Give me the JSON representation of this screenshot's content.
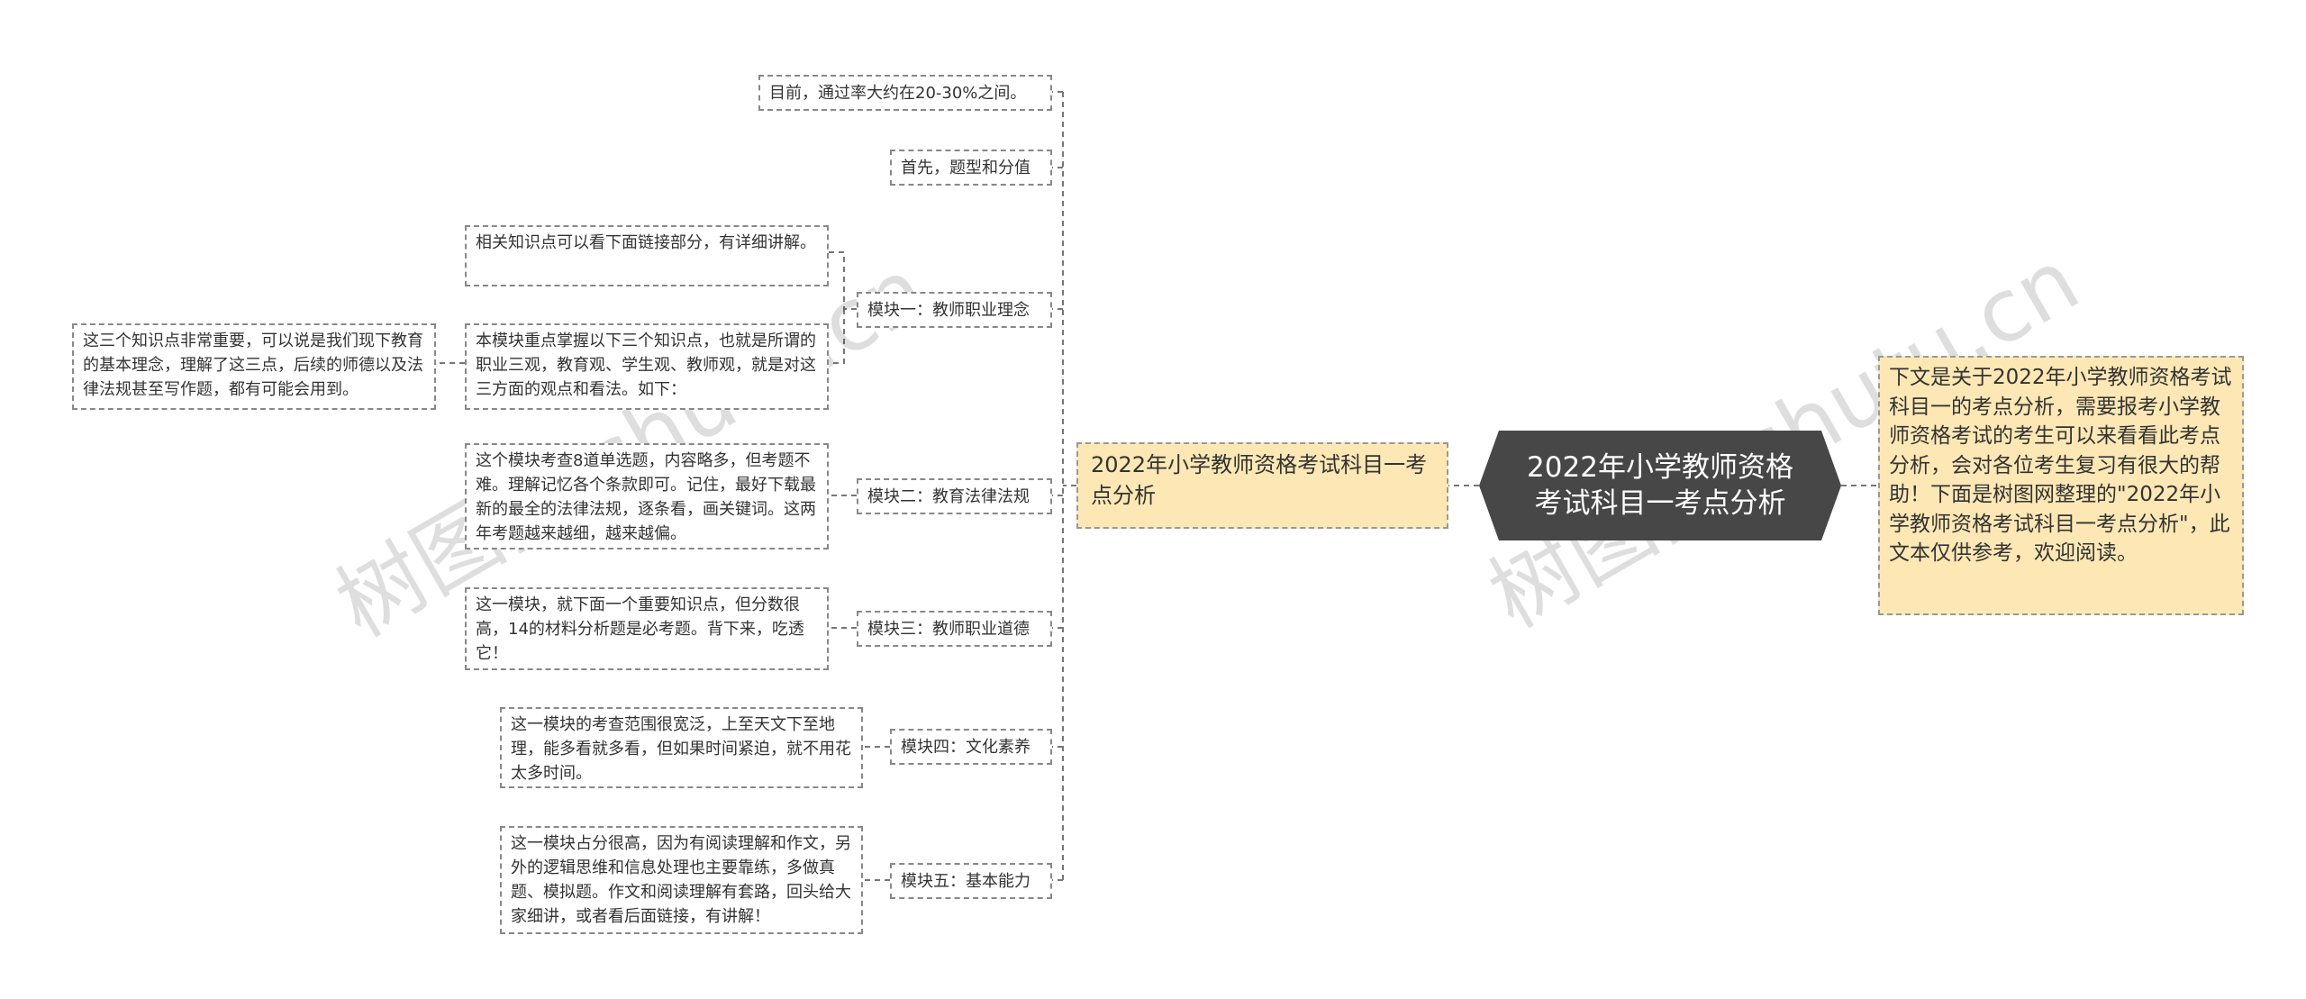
{
  "root": {
    "title": "2022年小学教师资格考试科目一考点分析"
  },
  "right_topic": {
    "text": "下文是关于2022年小学教师资格考试科目一的考点分析，需要报考小学教师资格考试的考生可以来看看此考点分析，会对各位考生复习有很大的帮助！下面是树图网整理的\"2022年小学教师资格考试科目一考点分析\"，此文本仅供参考，欢迎阅读。"
  },
  "left_topic": {
    "text": "2022年小学教师资格考试科目一考点分析"
  },
  "branches": {
    "pass_rate": "目前，通过率大约在20-30%之间。",
    "question_types": "首先，题型和分值",
    "module1": {
      "label": "模块一：教师职业理念",
      "detail1": "相关知识点可以看下面链接部分，有详细讲解。",
      "detail2": "本模块重点掌握以下三个知识点，也就是所谓的职业三观，教育观、学生观、教师观，就是对这三方面的观点和看法。如下：",
      "detail2_child": "这三个知识点非常重要，可以说是我们现下教育的基本理念，理解了这三点，后续的师德以及法律法规甚至写作题，都有可能会用到。"
    },
    "module2": {
      "label": "模块二：教育法律法规",
      "detail": "这个模块考查8道单选题，内容略多，但考题不难。理解记忆各个条款即可。记住，最好下载最新的最全的法律法规，逐条看，画关键词。这两年考题越来越细，越来越偏。"
    },
    "module3": {
      "label": "模块三：教师职业道德",
      "detail": "这一模块，就下面一个重要知识点，但分数很高，14的材料分析题是必考题。背下来，吃透它！"
    },
    "module4": {
      "label": "模块四：文化素养",
      "detail": "这一模块的考查范围很宽泛，上至天文下至地理，能多看就多看，但如果时间紧迫，就不用花太多时间。"
    },
    "module5": {
      "label": "模块五：基本能力",
      "detail": "这一模块占分很高，因为有阅读理解和作文，另外的逻辑思维和信息处理也主要靠练，多做真题、模拟题。作文和阅读理解有套路，回头给大家细讲，或者看后面链接，有讲解！"
    }
  },
  "watermarks": [
    "树图网 shutu.cn",
    "树图网 shutu.cn"
  ]
}
